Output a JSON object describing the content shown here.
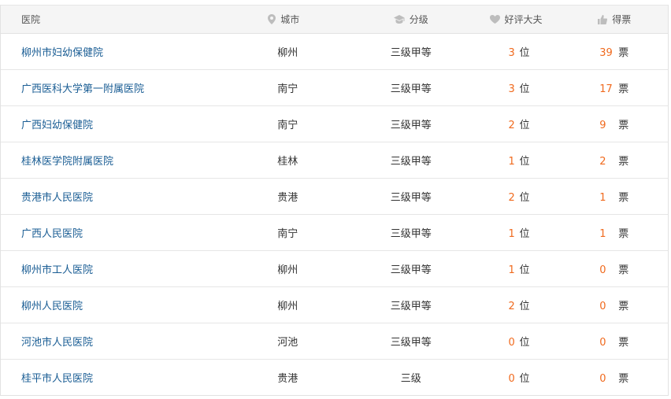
{
  "header": {
    "hospital": "医院",
    "city": "城市",
    "grade": "分级",
    "good_doctors": "好评大夫",
    "votes": "得票"
  },
  "icons": {
    "city": "location-pin-icon",
    "grade": "graduation-cap-icon",
    "good_doctors": "heart-icon",
    "votes": "thumbs-up-icon"
  },
  "colors": {
    "link": "#1a5d94",
    "accent": "#f06a1e"
  },
  "rows": [
    {
      "name": "柳州市妇幼保健院",
      "city": "柳州",
      "grade": "三级甲等",
      "doctors": "3",
      "doctors_unit": "位",
      "votes": "39",
      "votes_unit": "票"
    },
    {
      "name": "广西医科大学第一附属医院",
      "city": "南宁",
      "grade": "三级甲等",
      "doctors": "3",
      "doctors_unit": "位",
      "votes": "17",
      "votes_unit": "票"
    },
    {
      "name": "广西妇幼保健院",
      "city": "南宁",
      "grade": "三级甲等",
      "doctors": "2",
      "doctors_unit": "位",
      "votes": "9",
      "votes_unit": "票"
    },
    {
      "name": "桂林医学院附属医院",
      "city": "桂林",
      "grade": "三级甲等",
      "doctors": "1",
      "doctors_unit": "位",
      "votes": "2",
      "votes_unit": "票"
    },
    {
      "name": "贵港市人民医院",
      "city": "贵港",
      "grade": "三级甲等",
      "doctors": "2",
      "doctors_unit": "位",
      "votes": "1",
      "votes_unit": "票"
    },
    {
      "name": "广西人民医院",
      "city": "南宁",
      "grade": "三级甲等",
      "doctors": "1",
      "doctors_unit": "位",
      "votes": "1",
      "votes_unit": "票"
    },
    {
      "name": "柳州市工人医院",
      "city": "柳州",
      "grade": "三级甲等",
      "doctors": "1",
      "doctors_unit": "位",
      "votes": "0",
      "votes_unit": "票"
    },
    {
      "name": "柳州人民医院",
      "city": "柳州",
      "grade": "三级甲等",
      "doctors": "2",
      "doctors_unit": "位",
      "votes": "0",
      "votes_unit": "票"
    },
    {
      "name": "河池市人民医院",
      "city": "河池",
      "grade": "三级甲等",
      "doctors": "0",
      "doctors_unit": "位",
      "votes": "0",
      "votes_unit": "票"
    },
    {
      "name": "桂平市人民医院",
      "city": "贵港",
      "grade": "三级",
      "doctors": "0",
      "doctors_unit": "位",
      "votes": "0",
      "votes_unit": "票"
    }
  ]
}
